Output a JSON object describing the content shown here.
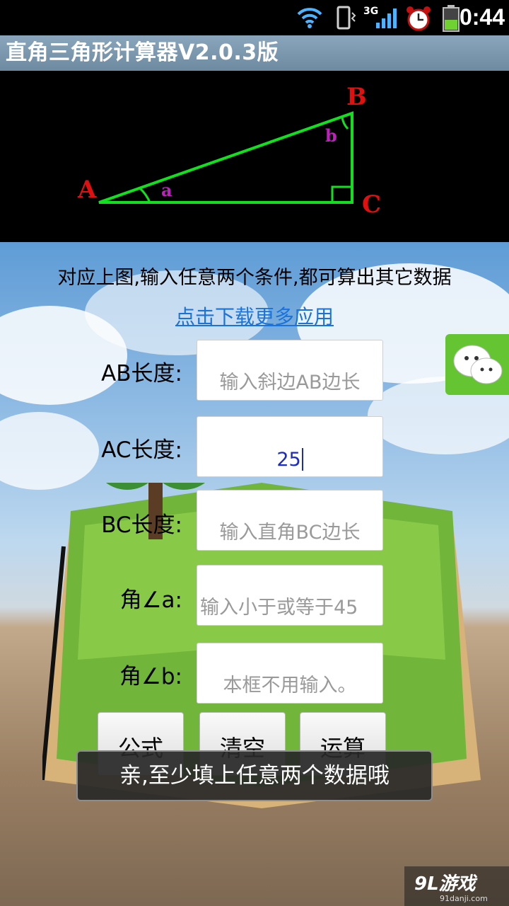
{
  "status_bar": {
    "time": "0:44",
    "network": "3G",
    "icons": [
      "wifi-icon",
      "vibrate-icon",
      "signal-icon",
      "alarm-icon",
      "battery-icon"
    ]
  },
  "app": {
    "title": "直角三角形计算器V2.0.3版"
  },
  "diagram": {
    "vertex_a": "A",
    "vertex_b": "B",
    "vertex_c": "C",
    "angle_a": "a",
    "angle_b": "b",
    "colors": {
      "line": "#12e01e",
      "vertex": "#e01010",
      "angle": "#c020c0"
    }
  },
  "main": {
    "instruction": "对应上图,输入任意两个条件,都可算出其它数据",
    "download_link": "点击下载更多应用"
  },
  "fields": [
    {
      "label": "AB长度:",
      "value": "",
      "placeholder": "输入斜边AB边长"
    },
    {
      "label": "AC长度:",
      "value": "25",
      "placeholder": ""
    },
    {
      "label": "BC长度:",
      "value": "",
      "placeholder": "输入直角BC边长"
    },
    {
      "label": "角∠a:",
      "value": "",
      "placeholder": "输入小于或等于45"
    },
    {
      "label": "角∠b:",
      "value": "",
      "placeholder": "本框不用输入。"
    }
  ],
  "buttons": {
    "formula": "公式",
    "clear": "清空",
    "calculate": "运算"
  },
  "toast": {
    "message": "亲,至少填上任意两个数据哦"
  },
  "watermark": {
    "main": "9L游戏",
    "sub": "91danji.com"
  }
}
